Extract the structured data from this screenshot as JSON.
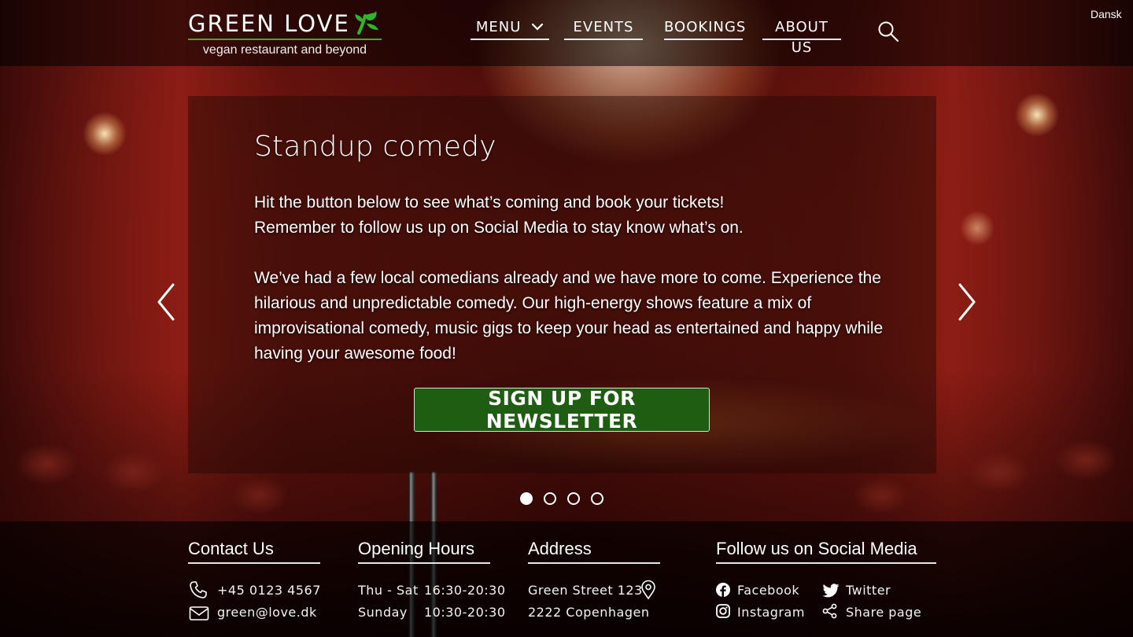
{
  "header": {
    "logo": {
      "title": "GREEN LOVE",
      "tagline": "vegan restaurant and beyond"
    },
    "nav": {
      "menu": "MENU",
      "events": "EVENTS",
      "bookings": "BOOKINGS",
      "about": "ABOUT US"
    },
    "language": "Dansk"
  },
  "hero": {
    "title": "Standup comedy",
    "paragraph1_line1": "Hit the button below to see what’s coming and book your tickets!",
    "paragraph1_line2": "Remember to follow us up on Social Media to stay know what’s on.",
    "paragraph2": "We’ve had a few local comedians already and we have more to come.  Experience the hilarious and unpredictable comedy. Our high-energy shows feature a mix of improvisational comedy, music gigs to keep your head as entertained and happy while having your awesome food!",
    "cta_label": "SIGN UP FOR NEWSLETTER",
    "slides_total": 4,
    "active_slide": 1
  },
  "footer": {
    "contact": {
      "heading": "Contact  Us",
      "phone": "+45 0123 4567",
      "email": "green@love.dk"
    },
    "hours": {
      "heading": "Opening Hours",
      "rows": [
        {
          "days": "Thu - Sat",
          "time": "16:30-20:30"
        },
        {
          "days": "Sunday",
          "time": "10:30-20:30"
        }
      ]
    },
    "address": {
      "heading": "Address",
      "street": "Green Street 123",
      "city": "2222 Copenhagen"
    },
    "social": {
      "heading": "Follow us on Social Media",
      "facebook": "Facebook",
      "twitter": "Twitter",
      "instagram": "Instagram",
      "share": "Share page"
    }
  },
  "colors": {
    "brand_green": "#2fb52a",
    "cta_green": "#1f5e12",
    "header_bg": "#000000",
    "stage_red": "#8a1d14"
  },
  "icons": [
    "leaf-logo-icon",
    "chevron-down-icon",
    "search-icon",
    "chevron-left-icon",
    "chevron-right-icon",
    "phone-icon",
    "mail-icon",
    "location-pin-icon",
    "facebook-icon",
    "twitter-icon",
    "instagram-icon",
    "share-icon"
  ]
}
